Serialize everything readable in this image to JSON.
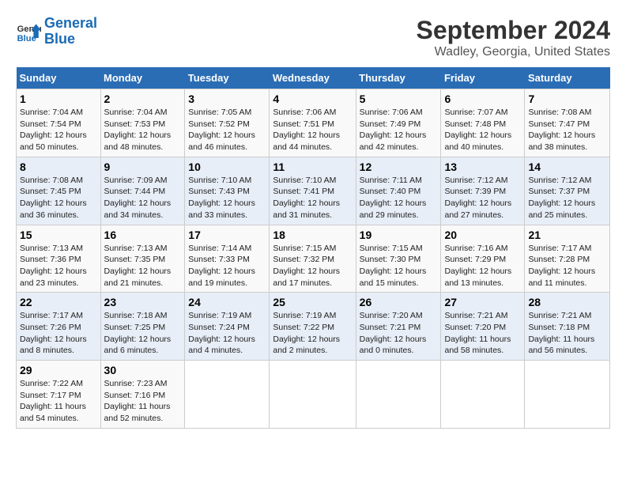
{
  "header": {
    "logo_line1": "General",
    "logo_line2": "Blue",
    "title": "September 2024",
    "subtitle": "Wadley, Georgia, United States"
  },
  "calendar": {
    "days_of_week": [
      "Sunday",
      "Monday",
      "Tuesday",
      "Wednesday",
      "Thursday",
      "Friday",
      "Saturday"
    ],
    "weeks": [
      [
        null,
        {
          "day": "2",
          "sunrise": "7:04 AM",
          "sunset": "7:53 PM",
          "daylight": "12 hours and 48 minutes."
        },
        {
          "day": "3",
          "sunrise": "7:05 AM",
          "sunset": "7:52 PM",
          "daylight": "12 hours and 46 minutes."
        },
        {
          "day": "4",
          "sunrise": "7:06 AM",
          "sunset": "7:51 PM",
          "daylight": "12 hours and 44 minutes."
        },
        {
          "day": "5",
          "sunrise": "7:06 AM",
          "sunset": "7:49 PM",
          "daylight": "12 hours and 42 minutes."
        },
        {
          "day": "6",
          "sunrise": "7:07 AM",
          "sunset": "7:48 PM",
          "daylight": "12 hours and 40 minutes."
        },
        {
          "day": "7",
          "sunrise": "7:08 AM",
          "sunset": "7:47 PM",
          "daylight": "12 hours and 38 minutes."
        }
      ],
      [
        {
          "day": "1",
          "sunrise": "7:04 AM",
          "sunset": "7:54 PM",
          "daylight": "12 hours and 50 minutes."
        },
        {
          "day": "9",
          "sunrise": "7:09 AM",
          "sunset": "7:44 PM",
          "daylight": "12 hours and 34 minutes."
        },
        {
          "day": "10",
          "sunrise": "7:10 AM",
          "sunset": "7:43 PM",
          "daylight": "12 hours and 33 minutes."
        },
        {
          "day": "11",
          "sunrise": "7:10 AM",
          "sunset": "7:41 PM",
          "daylight": "12 hours and 31 minutes."
        },
        {
          "day": "12",
          "sunrise": "7:11 AM",
          "sunset": "7:40 PM",
          "daylight": "12 hours and 29 minutes."
        },
        {
          "day": "13",
          "sunrise": "7:12 AM",
          "sunset": "7:39 PM",
          "daylight": "12 hours and 27 minutes."
        },
        {
          "day": "14",
          "sunrise": "7:12 AM",
          "sunset": "7:37 PM",
          "daylight": "12 hours and 25 minutes."
        }
      ],
      [
        {
          "day": "8",
          "sunrise": "7:08 AM",
          "sunset": "7:45 PM",
          "daylight": "12 hours and 36 minutes."
        },
        {
          "day": "16",
          "sunrise": "7:13 AM",
          "sunset": "7:35 PM",
          "daylight": "12 hours and 21 minutes."
        },
        {
          "day": "17",
          "sunrise": "7:14 AM",
          "sunset": "7:33 PM",
          "daylight": "12 hours and 19 minutes."
        },
        {
          "day": "18",
          "sunrise": "7:15 AM",
          "sunset": "7:32 PM",
          "daylight": "12 hours and 17 minutes."
        },
        {
          "day": "19",
          "sunrise": "7:15 AM",
          "sunset": "7:30 PM",
          "daylight": "12 hours and 15 minutes."
        },
        {
          "day": "20",
          "sunrise": "7:16 AM",
          "sunset": "7:29 PM",
          "daylight": "12 hours and 13 minutes."
        },
        {
          "day": "21",
          "sunrise": "7:17 AM",
          "sunset": "7:28 PM",
          "daylight": "12 hours and 11 minutes."
        }
      ],
      [
        {
          "day": "15",
          "sunrise": "7:13 AM",
          "sunset": "7:36 PM",
          "daylight": "12 hours and 23 minutes."
        },
        {
          "day": "23",
          "sunrise": "7:18 AM",
          "sunset": "7:25 PM",
          "daylight": "12 hours and 6 minutes."
        },
        {
          "day": "24",
          "sunrise": "7:19 AM",
          "sunset": "7:24 PM",
          "daylight": "12 hours and 4 minutes."
        },
        {
          "day": "25",
          "sunrise": "7:19 AM",
          "sunset": "7:22 PM",
          "daylight": "12 hours and 2 minutes."
        },
        {
          "day": "26",
          "sunrise": "7:20 AM",
          "sunset": "7:21 PM",
          "daylight": "12 hours and 0 minutes."
        },
        {
          "day": "27",
          "sunrise": "7:21 AM",
          "sunset": "7:20 PM",
          "daylight": "11 hours and 58 minutes."
        },
        {
          "day": "28",
          "sunrise": "7:21 AM",
          "sunset": "7:18 PM",
          "daylight": "11 hours and 56 minutes."
        }
      ],
      [
        {
          "day": "22",
          "sunrise": "7:17 AM",
          "sunset": "7:26 PM",
          "daylight": "12 hours and 8 minutes."
        },
        {
          "day": "30",
          "sunrise": "7:23 AM",
          "sunset": "7:16 PM",
          "daylight": "11 hours and 52 minutes."
        },
        null,
        null,
        null,
        null,
        null
      ],
      [
        {
          "day": "29",
          "sunrise": "7:22 AM",
          "sunset": "7:17 PM",
          "daylight": "11 hours and 54 minutes."
        },
        null,
        null,
        null,
        null,
        null,
        null
      ]
    ]
  }
}
